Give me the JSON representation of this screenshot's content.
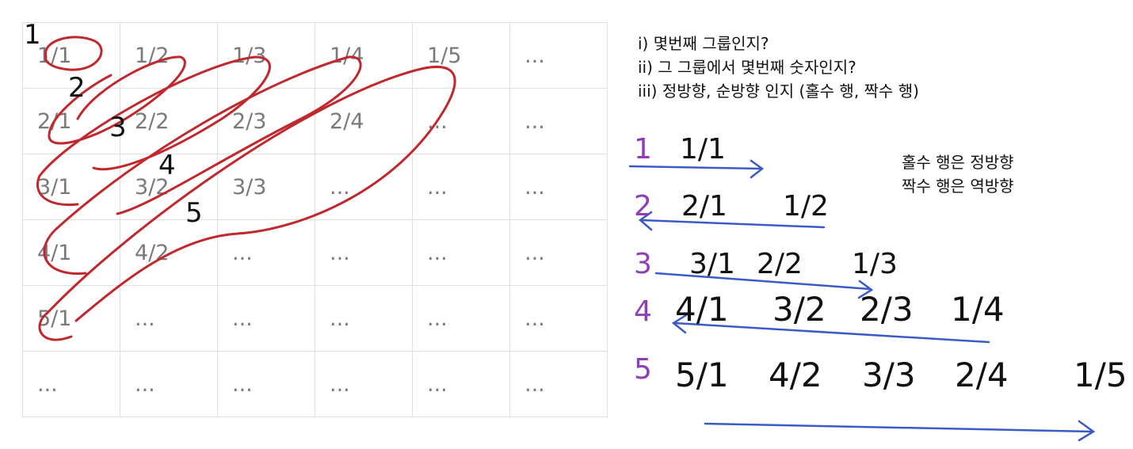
{
  "grid": {
    "rows": [
      [
        "1/1",
        "1/2",
        "1/3",
        "1/4",
        "1/5",
        "..."
      ],
      [
        "2/1",
        "2/2",
        "2/3",
        "2/4",
        "...",
        "..."
      ],
      [
        "3/1",
        "3/2",
        "3/3",
        "...",
        "...",
        "..."
      ],
      [
        "4/1",
        "4/2",
        "...",
        "...",
        "...",
        "..."
      ],
      [
        "5/1",
        "...",
        "...",
        "...",
        "...",
        "..."
      ],
      [
        "...",
        "...",
        "...",
        "...",
        "...",
        "..."
      ]
    ]
  },
  "notes": {
    "q1": "i) 몇번째 그룹인지?",
    "q2": "ii) 그 그룹에서 몇번째 숫자인지?",
    "q3": "iii) 정방향, 순방향 인지 (홀수 행, 짝수 행)"
  },
  "side_note": {
    "line1": "홀수 행은 정방향",
    "line2": "짝수 행은 역방향"
  },
  "grid_group_labels": [
    "1",
    "2",
    "3",
    "4",
    "5"
  ],
  "groups": [
    {
      "label": "1",
      "items": [
        "1/1"
      ]
    },
    {
      "label": "2",
      "items": [
        "2/1",
        "1/2"
      ]
    },
    {
      "label": "3",
      "items": [
        "3/1",
        "2/2",
        "1/3"
      ]
    },
    {
      "label": "4",
      "items": [
        "4/1",
        "3/2",
        "2/3",
        "1/4"
      ]
    },
    {
      "label": "5",
      "items": [
        "5/1",
        "4/2",
        "3/3",
        "2/4",
        "1/5"
      ]
    }
  ],
  "colors": {
    "grid_text": "#7a7a7a",
    "grid_border": "#e0e0e0",
    "loop_red": "#c0282d",
    "arrow_blue": "#3a5bc7",
    "label_purple": "#8e3fb5",
    "ink": "#111111"
  }
}
